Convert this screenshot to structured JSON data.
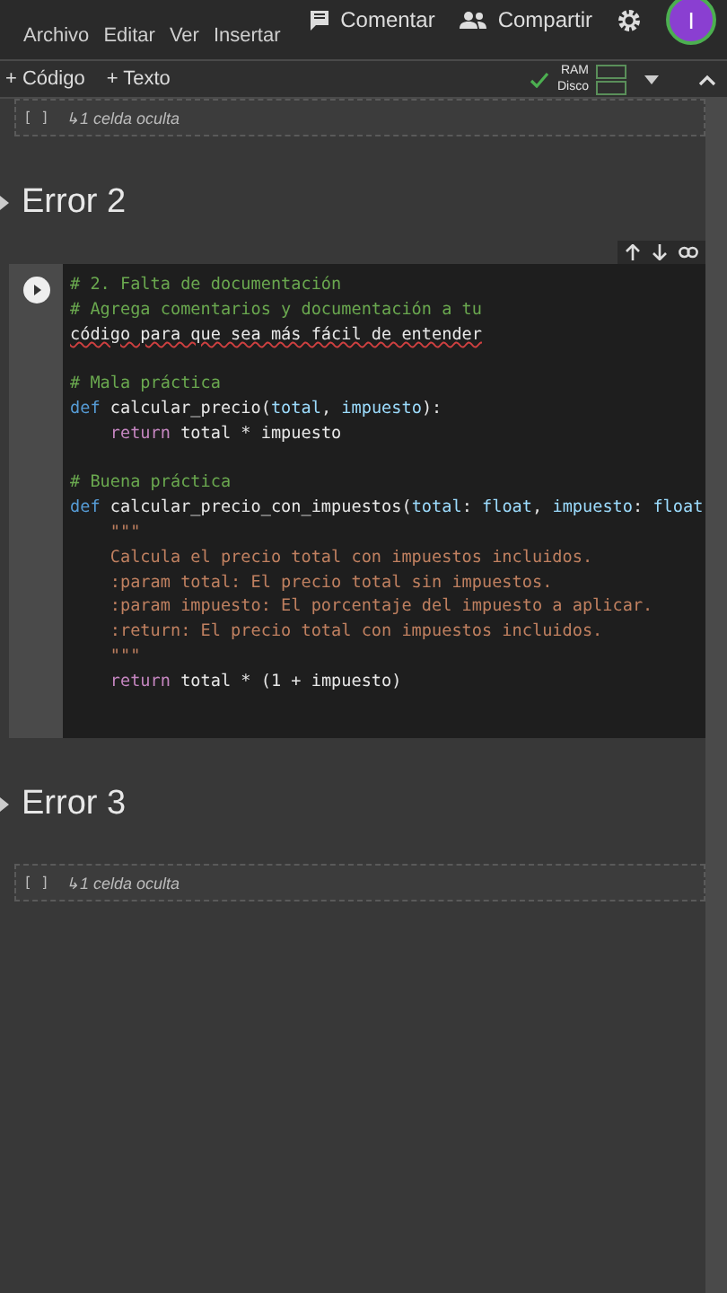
{
  "menu": [
    "Archivo",
    "Editar",
    "Ver",
    "Insertar"
  ],
  "header_actions": [
    {
      "label": "Comentar",
      "kind": "comment"
    },
    {
      "label": "Compartir",
      "kind": "share"
    }
  ],
  "avatar": {
    "initial": "I"
  },
  "toolbar": {
    "add_buttons": [
      "+ Código",
      "+ Texto"
    ],
    "resources": [
      "RAM",
      "Disco"
    ],
    "connected": true
  },
  "sections": [
    {
      "kind": "hidden",
      "bracket": "[ ]",
      "label": "↳1 celda oculta"
    },
    {
      "kind": "heading",
      "title": "Error 2"
    },
    {
      "kind": "code",
      "lines": [
        [
          {
            "text": "# 2. Falta de documentación",
            "kind": "comment"
          }
        ],
        [
          {
            "text": "# Agrega comentarios y documentación a tu",
            "kind": "comment"
          }
        ],
        [
          {
            "text": "código para que sea más fácil de entender",
            "kind": "plain",
            "misspelled": true
          }
        ],
        {
          "kind": "blank"
        },
        [
          {
            "text": "# Mala práctica",
            "kind": "comment"
          }
        ],
        [
          {
            "text": "def ",
            "kind": "keyword"
          },
          {
            "text": "calcular_precio(",
            "kind": "plain"
          },
          {
            "text": "total",
            "kind": "param"
          },
          {
            "text": ", ",
            "kind": "plain"
          },
          {
            "text": "impuesto",
            "kind": "param"
          },
          {
            "text": "):",
            "kind": "plain"
          }
        ],
        [
          {
            "text": "    return",
            "kind": "control"
          },
          {
            "text": " total * impuesto",
            "kind": "plain"
          }
        ],
        {
          "kind": "blank"
        },
        [
          {
            "text": "# Buena práctica",
            "kind": "comment"
          }
        ],
        [
          {
            "text": "def ",
            "kind": "keyword"
          },
          {
            "text": "calcular_precio_con_impuestos(",
            "kind": "plain"
          },
          {
            "text": "total",
            "kind": "param"
          },
          {
            "text": ": ",
            "kind": "plain"
          },
          {
            "text": "float",
            "kind": "param"
          },
          {
            "text": ", ",
            "kind": "plain"
          },
          {
            "text": "impuesto",
            "kind": "param"
          },
          {
            "text": ": ",
            "kind": "plain"
          },
          {
            "text": "float",
            "kind": "param"
          }
        ],
        [
          {
            "text": "    \"\"\"",
            "kind": "string"
          }
        ],
        [
          {
            "text": "    Calcula el precio total con impuestos incluidos.",
            "kind": "string"
          }
        ],
        [
          {
            "text": "    :param total: El precio total sin impuestos.",
            "kind": "string"
          }
        ],
        [
          {
            "text": "    :param impuesto: El porcentaje del impuesto a aplicar.",
            "kind": "string"
          }
        ],
        [
          {
            "text": "    :return: El precio total con impuestos incluidos.",
            "kind": "string"
          }
        ],
        [
          {
            "text": "    \"\"\"",
            "kind": "string"
          }
        ],
        [
          {
            "text": "    return",
            "kind": "control"
          },
          {
            "text": " total * (1 + impuesto)",
            "kind": "plain"
          }
        ]
      ]
    },
    {
      "kind": "heading",
      "title": "Error 3"
    },
    {
      "kind": "hidden",
      "bracket": "[ ]",
      "label": "↳1 celda oculta"
    }
  ]
}
